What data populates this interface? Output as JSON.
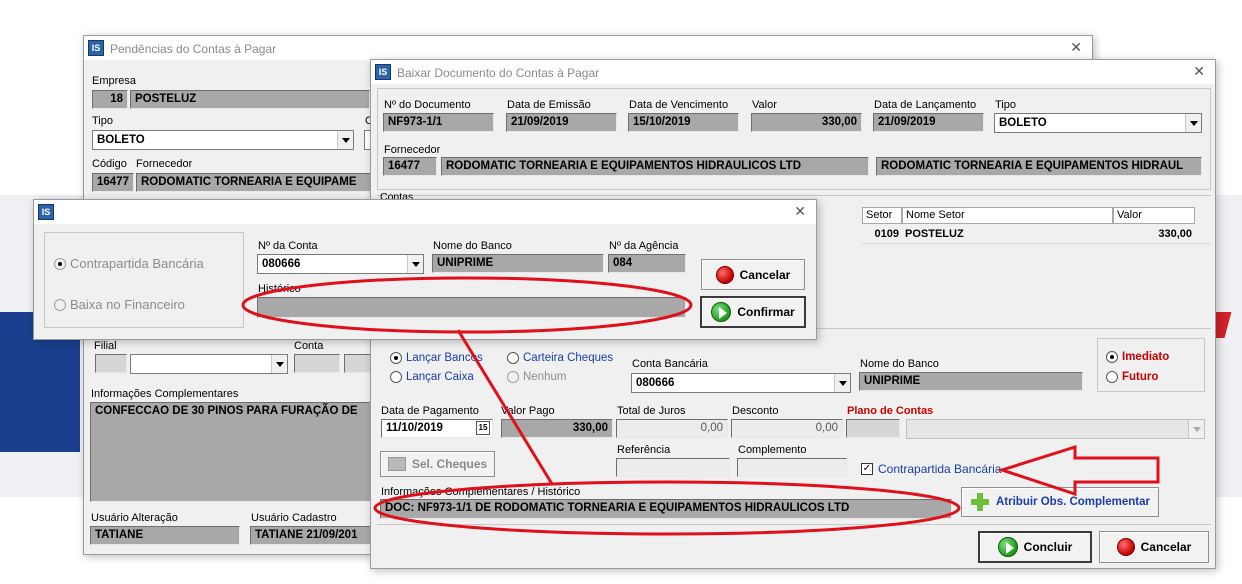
{
  "win_pend": {
    "title": "Pendências do Contas à Pagar",
    "empresa_label": "Empresa",
    "empresa_code": "18",
    "empresa_name": "POSTELUZ",
    "tipo_label": "Tipo",
    "tipo_value": "BOLETO",
    "o_label": "O",
    "codigo_label": "Código",
    "fornecedor_label": "Fornecedor",
    "fornecedor_code": "16477",
    "fornecedor_name": "RODOMATIC TORNEARIA E EQUIPAME",
    "filial_label": "Filial",
    "conta_label": "Conta",
    "info_label": "Informações Complementares",
    "info_value": "CONFECCAO DE 30 PINOS PARA FURAÇÃO DE",
    "usuario_alt_label": "Usuário Alteração",
    "usuario_alt_value": "TATIANE",
    "usuario_cad_label": "Usuário Cadastro",
    "usuario_cad_value": "TATIANE 21/09/201"
  },
  "win_baixar": {
    "title": "Baixar Documento do Contas à Pagar",
    "ndoc_label": "Nº do Documento",
    "ndoc_value": "NF973-1/1",
    "emissao_label": "Data de Emissão",
    "emissao_value": "21/09/2019",
    "venc_label": "Data de Vencimento",
    "venc_value": "15/10/2019",
    "valor_label": "Valor",
    "valor_value": "330,00",
    "lanc_label": "Data de Lançamento",
    "lanc_value": "21/09/2019",
    "tipo_label": "Tipo",
    "tipo_value": "BOLETO",
    "fornecedor_label": "Fornecedor",
    "fornecedor_code": "16477",
    "fornecedor_name": "RODOMATIC TORNEARIA E EQUIPAMENTOS HIDRAULICOS LTD",
    "fornecedor_name2": "RODOMATIC TORNEARIA E EQUIPAMENTOS HIDRAUL",
    "contas_label": "Contas",
    "grid_headers": [
      "Setor",
      "Nome Setor",
      "Valor"
    ],
    "grid_row": [
      "0109",
      "POSTELUZ",
      "330,00"
    ],
    "opt_lancar_bancos": "Lançar Bancos",
    "opt_carteira_cheques": "Carteira Cheques",
    "opt_lancar_caixa": "Lançar Caixa",
    "opt_nenhum": "Nenhum",
    "conta_bancaria_label": "Conta Bancária",
    "conta_bancaria_value": "080666",
    "nome_banco_label": "Nome do Banco",
    "nome_banco_value": "UNIPRIME",
    "opt_imediato": "Imediato",
    "opt_futuro": "Futuro",
    "data_pag_label": "Data de Pagamento",
    "data_pag_value": "11/10/2019",
    "cal_icon_text": "15",
    "valor_pago_label": "Valor Pago",
    "valor_pago_value": "330,00",
    "juros_label": "Total de Juros",
    "juros_value": "0,00",
    "desconto_label": "Desconto",
    "desconto_value": "0,00",
    "plano_label": "Plano de Contas",
    "sel_cheques": "Sel. Cheques",
    "referencia_label": "Referência",
    "complemento_label": "Complemento",
    "contrapartida_label": "Contrapartida Bancária",
    "contrapartida_checked": "✓",
    "info_hist_label": "Informações Complementares / Histórico",
    "info_hist_value": "DOC: NF973-1/1 DE RODOMATIC TORNEARIA E EQUIPAMENTOS HIDRAULICOS LTD",
    "atribuir_btn": "Atribuir Obs. Complementar",
    "concluir_btn": "Concluir",
    "cancelar_btn": "Cancelar"
  },
  "win_dialog": {
    "opt_contrapartida": "Contrapartida Bancária",
    "opt_baixa": "Baixa no Financeiro",
    "nconta_label": "Nº da Conta",
    "nconta_value": "080666",
    "nome_banco_label": "Nome do Banco",
    "nome_banco_value": "UNIPRIME",
    "nagencia_label": "Nº da Agência",
    "nagencia_value": "084",
    "historico_label": "Histórico",
    "historico_value": "",
    "cancelar_btn": "Cancelar",
    "confirmar_btn": "Confirmar"
  },
  "icons": [
    "app-icon",
    "close-icon",
    "stop-icon",
    "confirm-icon",
    "plus-icon",
    "calendar-icon",
    "cheque-icon",
    "dropdown-arrow-icon"
  ],
  "colors": {
    "annotation_red": "#e0101a",
    "field_gray": "#a8a8a8",
    "label_red": "#cc0000",
    "label_blue": "#1a3ea8"
  }
}
